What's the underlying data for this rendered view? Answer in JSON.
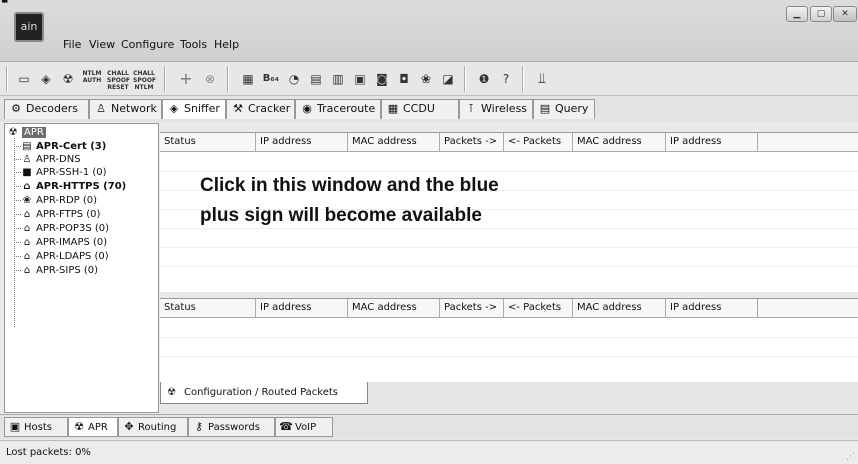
{
  "app": {
    "logo_text": "ain"
  },
  "menu": [
    "File",
    "View",
    "Configure",
    "Tools",
    "Help"
  ],
  "window_buttons": [
    "minimize",
    "maximize",
    "close"
  ],
  "toolbar": {
    "small_labels": [
      "NTLM AUTH",
      "CHALL SPOOF RESET",
      "CHALL SPOOF NTLM"
    ],
    "b64_label": "B₆₄"
  },
  "tabs": [
    "Decoders",
    "Network",
    "Sniffer",
    "Cracker",
    "Traceroute",
    "CCDU",
    "Wireless",
    "Query"
  ],
  "tree": {
    "root": "APR",
    "items": [
      {
        "label": "APR-Cert (3)",
        "bold": true
      },
      {
        "label": "APR-DNS",
        "bold": false
      },
      {
        "label": "APR-SSH-1 (0)",
        "bold": false
      },
      {
        "label": "APR-HTTPS (70)",
        "bold": true
      },
      {
        "label": "APR-RDP (0)",
        "bold": false
      },
      {
        "label": "APR-FTPS (0)",
        "bold": false
      },
      {
        "label": "APR-POP3S (0)",
        "bold": false
      },
      {
        "label": "APR-IMAPS (0)",
        "bold": false
      },
      {
        "label": "APR-LDAPS (0)",
        "bold": false
      },
      {
        "label": "APR-SIPS (0)",
        "bold": false
      }
    ]
  },
  "table_columns": [
    "Status",
    "IP address",
    "MAC address",
    "Packets ->",
    "<- Packets",
    "MAC address",
    "IP address"
  ],
  "instruction": [
    "Click in this window and the blue",
    "plus sign will become available"
  ],
  "sub_tab": "Configuration / Routed Packets",
  "bottom_tabs": [
    "Hosts",
    "APR",
    "Routing",
    "Passwords",
    "VoIP"
  ],
  "status": "Lost packets:  0%"
}
